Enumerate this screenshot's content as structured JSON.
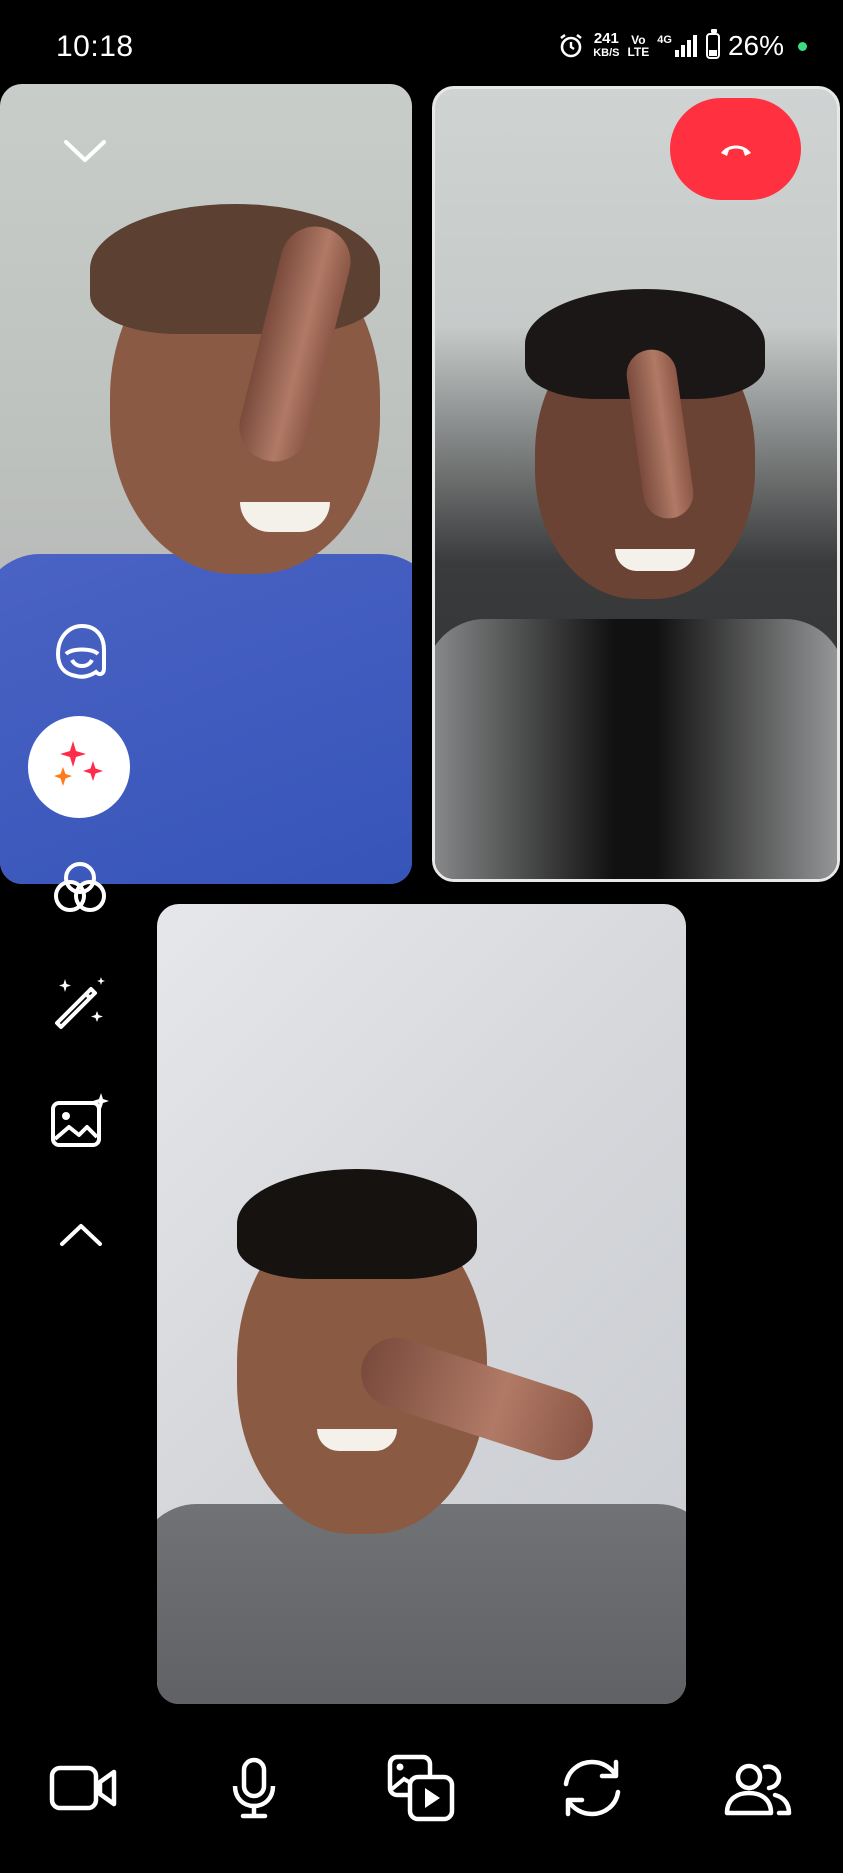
{
  "status_bar": {
    "time": "10:18",
    "net_speed_value": "241",
    "net_speed_unit": "KB/S",
    "volte_top": "Vo",
    "volte_bottom": "LTE",
    "network": "4G",
    "battery": "26%"
  },
  "icons": {
    "collapse": "chevron-down-icon",
    "end_call": "hang-up-icon",
    "avatar": "avatar-sticker-icon",
    "effects": "sparkles-icon",
    "filters": "overlapping-circles-icon",
    "magic": "magic-wand-icon",
    "backgrounds": "image-sparkle-icon",
    "more": "chevron-up-icon",
    "camera": "video-camera-icon",
    "mic": "microphone-icon",
    "share": "media-share-icon",
    "flip": "flip-camera-icon",
    "people": "people-icon"
  },
  "colors": {
    "end_call": "#ff3040",
    "effects_red": "#ff2b4a",
    "effects_orange": "#ff7a1a",
    "background": "#000000"
  }
}
